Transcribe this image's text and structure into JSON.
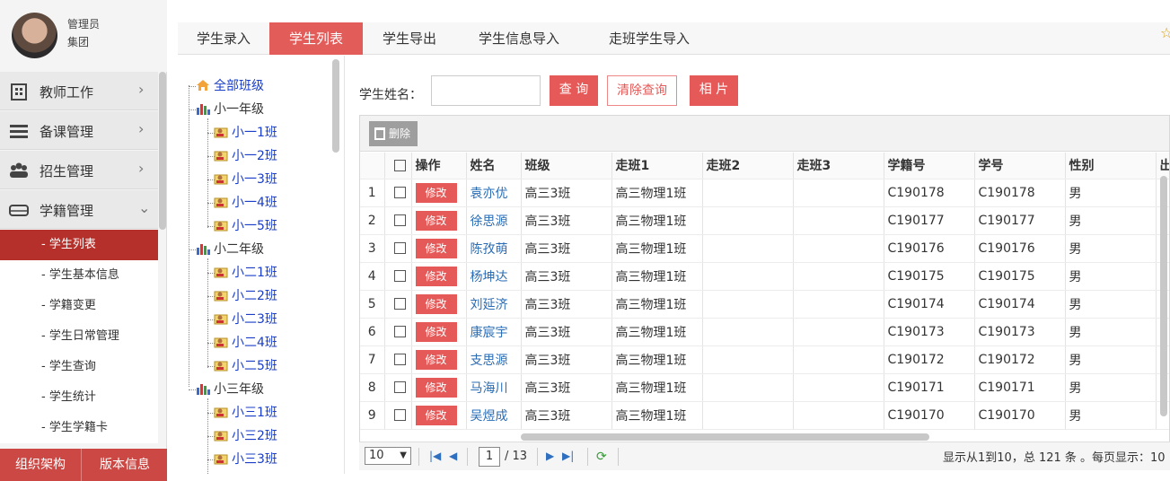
{
  "profile": {
    "role": "管理员",
    "org": "集团"
  },
  "sidebar": {
    "menus": [
      {
        "label": "教师工作",
        "icon": "building-icon"
      },
      {
        "label": "备课管理",
        "icon": "list-icon"
      },
      {
        "label": "招生管理",
        "icon": "users-icon"
      },
      {
        "label": "学籍管理",
        "icon": "drive-icon"
      }
    ],
    "submenu": [
      "- 学生列表",
      "- 学生基本信息",
      "- 学籍变更",
      "- 学生日常管理",
      "- 学生查询",
      "- 学生统计",
      "- 学生学籍卡"
    ],
    "bottom": [
      "组织架构",
      "版本信息"
    ]
  },
  "tabs": [
    "学生录入",
    "学生列表",
    "学生导出",
    "学生信息导入",
    "走班学生导入"
  ],
  "tree": {
    "root": "全部班级",
    "grades": [
      {
        "name": "小一年级",
        "classes": [
          "小一1班",
          "小一2班",
          "小一3班",
          "小一4班",
          "小一5班"
        ]
      },
      {
        "name": "小二年级",
        "classes": [
          "小二1班",
          "小二2班",
          "小二3班",
          "小二4班",
          "小二5班"
        ]
      },
      {
        "name": "小三年级",
        "classes": [
          "小三1班",
          "小三2班",
          "小三3班"
        ]
      }
    ]
  },
  "search": {
    "label": "学生姓名：",
    "value": "",
    "query": "查 询",
    "clear": "清除查询",
    "photo": "相 片"
  },
  "toolbar": {
    "delete": "删除"
  },
  "table": {
    "headers": [
      "操作",
      "姓名",
      "班级",
      "走班1",
      "走班2",
      "走班3",
      "学籍号",
      "学号",
      "性别",
      "出"
    ],
    "edit_label": "修改",
    "rows": [
      [
        "1",
        "袁亦优",
        "高三3班",
        "高三物理1班",
        "",
        "",
        "C190178",
        "C190178",
        "男"
      ],
      [
        "2",
        "徐思源",
        "高三3班",
        "高三物理1班",
        "",
        "",
        "C190177",
        "C190177",
        "男"
      ],
      [
        "3",
        "陈孜萌",
        "高三3班",
        "高三物理1班",
        "",
        "",
        "C190176",
        "C190176",
        "男"
      ],
      [
        "4",
        "杨坤达",
        "高三3班",
        "高三物理1班",
        "",
        "",
        "C190175",
        "C190175",
        "男"
      ],
      [
        "5",
        "刘延济",
        "高三3班",
        "高三物理1班",
        "",
        "",
        "C190174",
        "C190174",
        "男"
      ],
      [
        "6",
        "康宸宇",
        "高三3班",
        "高三物理1班",
        "",
        "",
        "C190173",
        "C190173",
        "男"
      ],
      [
        "7",
        "支思源",
        "高三3班",
        "高三物理1班",
        "",
        "",
        "C190172",
        "C190172",
        "男"
      ],
      [
        "8",
        "马海川",
        "高三3班",
        "高三物理1班",
        "",
        "",
        "C190171",
        "C190171",
        "男"
      ],
      [
        "9",
        "吴煜成",
        "高三3班",
        "高三物理1班",
        "",
        "",
        "C190170",
        "C190170",
        "男"
      ]
    ]
  },
  "pager": {
    "size": "10",
    "page": "1",
    "total": "/ 13",
    "info": "显示从1到10，总 121 条 。每页显示：10"
  }
}
